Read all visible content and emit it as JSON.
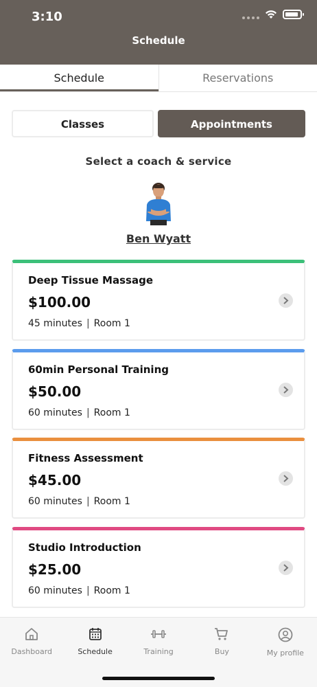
{
  "status": {
    "time": "3:10"
  },
  "header": {
    "title": "Schedule"
  },
  "tabs": [
    {
      "label": "Schedule",
      "active": true
    },
    {
      "label": "Reservations",
      "active": false
    }
  ],
  "segments": {
    "classes": "Classes",
    "appointments": "Appointments",
    "selected": "appointments"
  },
  "select_label": "Select a coach & service",
  "coach": {
    "name": "Ben Wyatt"
  },
  "services": [
    {
      "name": "Deep Tissue Massage",
      "price": "$100.00",
      "duration": "45 minutes",
      "room": "Room 1",
      "color": "#3cc079"
    },
    {
      "name": "60min Personal Training",
      "price": "$50.00",
      "duration": "60 minutes",
      "room": "Room 1",
      "color": "#5b9ced"
    },
    {
      "name": "Fitness Assessment",
      "price": "$45.00",
      "duration": "60 minutes",
      "room": "Room 1",
      "color": "#ea8f3e"
    },
    {
      "name": "Studio Introduction",
      "price": "$25.00",
      "duration": "60 minutes",
      "room": "Room 1",
      "color": "#e04a82"
    }
  ],
  "bottom_nav": [
    {
      "label": "Dashboard",
      "icon": "home-icon",
      "active": false
    },
    {
      "label": "Schedule",
      "icon": "calendar-icon",
      "active": true
    },
    {
      "label": "Training",
      "icon": "dumbbell-icon",
      "active": false
    },
    {
      "label": "Buy",
      "icon": "cart-icon",
      "active": false
    },
    {
      "label": "My profile",
      "icon": "user-circle-icon",
      "active": false
    }
  ],
  "colors": {
    "header_bg": "#67605a",
    "active_segment": "#635b55"
  }
}
